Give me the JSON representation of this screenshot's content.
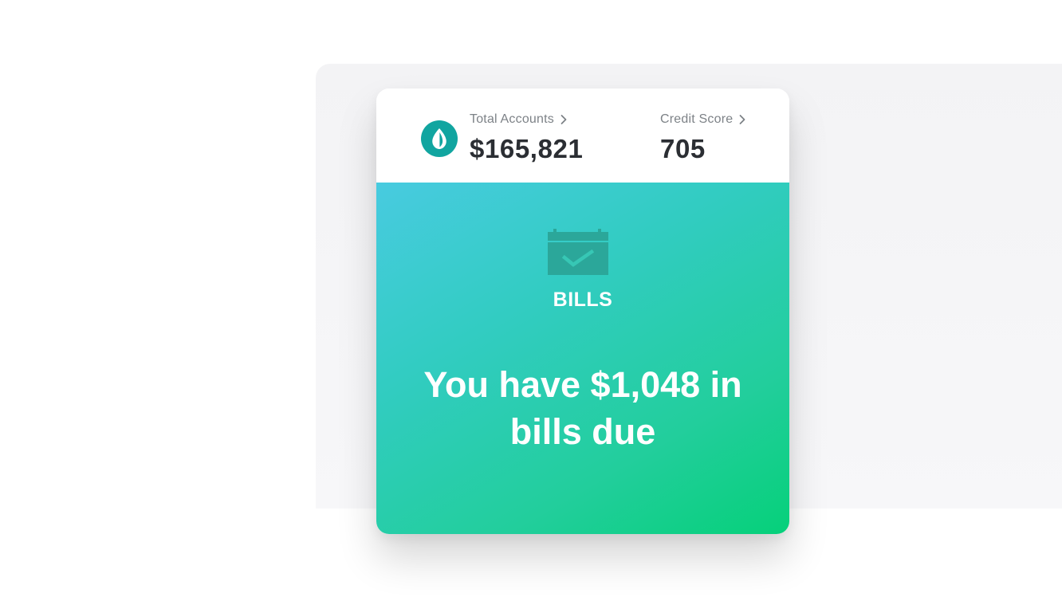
{
  "header": {
    "logo_icon": "mint-leaf-icon",
    "total_accounts": {
      "label": "Total Accounts",
      "value": "$165,821",
      "chevron_icon": "chevron-right-icon"
    },
    "credit_score": {
      "label": "Credit Score",
      "value": "705",
      "chevron_icon": "chevron-right-icon"
    }
  },
  "bills_card": {
    "icon": "calendar-check-icon",
    "title": "BILLS",
    "message": "You have $1,048 in bills due"
  },
  "colors": {
    "brand_teal": "#11a5a0",
    "gradient_start": "#48cbe0",
    "gradient_end": "#06d07a",
    "value_text": "#2b2e33",
    "label_text": "#7d8287"
  }
}
